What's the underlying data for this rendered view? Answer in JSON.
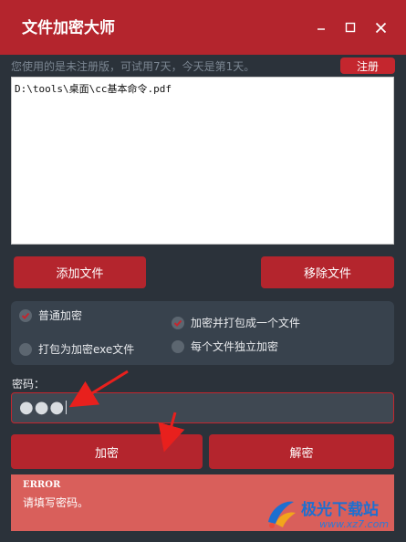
{
  "window": {
    "title": "文件加密大师",
    "controls": {
      "minimize": "–",
      "maximize": "□",
      "close": "✕"
    }
  },
  "notice": {
    "text": "您使用的是未注册版，可试用7天，今天是第1天。",
    "register_label": "注册"
  },
  "file_list": {
    "items": [
      "D:\\tools\\桌面\\cc基本命令.pdf"
    ]
  },
  "actions": {
    "add_label": "添加文件",
    "remove_label": "移除文件"
  },
  "options": [
    {
      "label": "普通加密",
      "checked": true
    },
    {
      "label": "打包为加密exe文件",
      "checked": false
    },
    {
      "label": "加密并打包成一个文件",
      "checked": true
    },
    {
      "label": "每个文件独立加密",
      "checked": false
    }
  ],
  "password": {
    "label": "密码：",
    "value": "●●●"
  },
  "buttons": {
    "encrypt_label": "加密",
    "decrypt_label": "解密"
  },
  "error": {
    "title": "ERROR",
    "message": "请填写密码。"
  },
  "watermark": {
    "name": "极光下载站",
    "url": "www.xz7.com"
  },
  "colors": {
    "accent": "#b4252d",
    "background": "#2b323a",
    "error_bg": "#d95f5b"
  }
}
